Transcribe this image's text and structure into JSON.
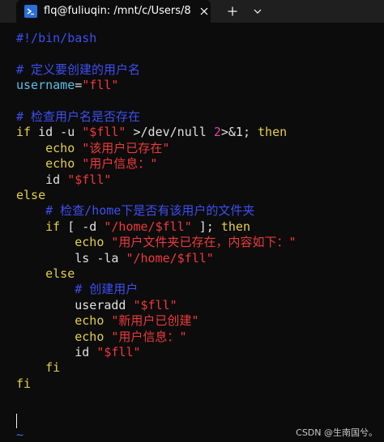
{
  "window": {
    "tab_title": "flq@fuliuqin: /mnt/c/Users/8",
    "tab_icon": "terminal-icon",
    "close_icon": "close-icon",
    "new_tab_icon": "plus-icon",
    "dropdown_icon": "chevron-down-icon"
  },
  "colors": {
    "keyword": "#e3d049",
    "string": "#ee3a3a",
    "comment": "#3d4ff0",
    "variable": "#5ac0e8",
    "plain": "#e0e0e0",
    "number": "#d946a8",
    "background": "#0c0c0c"
  },
  "editor": {
    "lines": [
      [
        {
          "t": "#!/bin/bash",
          "c": "c"
        }
      ],
      [],
      [
        {
          "t": "# 定义要创建的用户名",
          "c": "c"
        }
      ],
      [
        {
          "t": "username",
          "c": "v"
        },
        {
          "t": "=",
          "c": "p"
        },
        {
          "t": "\"fll\"",
          "c": "s"
        }
      ],
      [],
      [
        {
          "t": "# 检查用户名是否存在",
          "c": "c"
        }
      ],
      [
        {
          "t": "if",
          "c": "k"
        },
        {
          "t": " id -u ",
          "c": "p"
        },
        {
          "t": "\"$fll\"",
          "c": "s"
        },
        {
          "t": " >/dev/null ",
          "c": "p"
        },
        {
          "t": "2",
          "c": "n"
        },
        {
          "t": ">&1; ",
          "c": "p"
        },
        {
          "t": "then",
          "c": "k"
        }
      ],
      [
        {
          "t": "    echo ",
          "c": "k"
        },
        {
          "t": "\"该用户已存在\"",
          "c": "s"
        }
      ],
      [
        {
          "t": "    echo ",
          "c": "k"
        },
        {
          "t": "\"用户信息：\"",
          "c": "s"
        }
      ],
      [
        {
          "t": "    id ",
          "c": "p"
        },
        {
          "t": "\"$fll\"",
          "c": "s"
        }
      ],
      [
        {
          "t": "else",
          "c": "k"
        }
      ],
      [
        {
          "t": "    # 检查/home下是否有该用户的文件夹",
          "c": "c"
        }
      ],
      [
        {
          "t": "    if",
          "c": "k"
        },
        {
          "t": " [ -d ",
          "c": "p"
        },
        {
          "t": "\"/home/$fll\"",
          "c": "s"
        },
        {
          "t": " ]; ",
          "c": "p"
        },
        {
          "t": "then",
          "c": "k"
        }
      ],
      [
        {
          "t": "        echo ",
          "c": "k"
        },
        {
          "t": "\"用户文件夹已存在，内容如下：\"",
          "c": "s"
        }
      ],
      [
        {
          "t": "        ls -la ",
          "c": "p"
        },
        {
          "t": "\"/home/$fll\"",
          "c": "s"
        }
      ],
      [
        {
          "t": "    else",
          "c": "k"
        }
      ],
      [
        {
          "t": "        # 创建用户",
          "c": "c"
        }
      ],
      [
        {
          "t": "        useradd ",
          "c": "p"
        },
        {
          "t": "\"$fll\"",
          "c": "s"
        }
      ],
      [
        {
          "t": "        echo ",
          "c": "k"
        },
        {
          "t": "\"新用户已创建\"",
          "c": "s"
        }
      ],
      [
        {
          "t": "        echo ",
          "c": "k"
        },
        {
          "t": "\"用户信息：\"",
          "c": "s"
        }
      ],
      [
        {
          "t": "        id ",
          "c": "p"
        },
        {
          "t": "\"$fll\"",
          "c": "s"
        }
      ],
      [
        {
          "t": "    fi",
          "c": "k"
        }
      ],
      [
        {
          "t": "fi",
          "c": "k"
        }
      ]
    ],
    "empty_line_marker": "~"
  },
  "watermark": "CSDN @生南国兮。"
}
